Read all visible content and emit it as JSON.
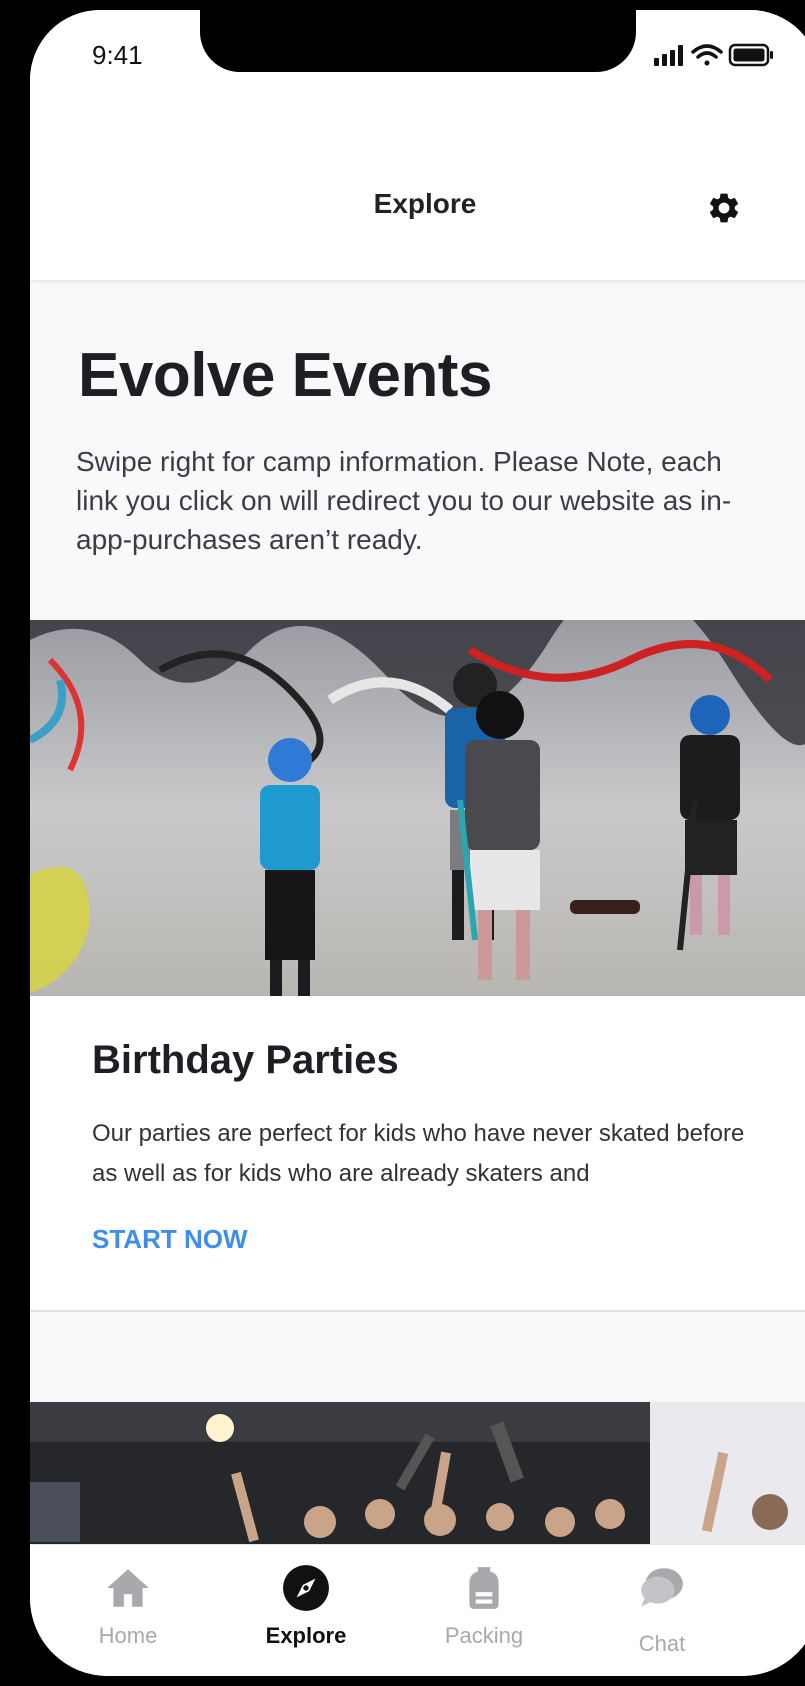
{
  "status_bar": {
    "time": "9:41"
  },
  "nav": {
    "title": "Explore"
  },
  "hero": {
    "title": "Evolve Events",
    "description": "Swipe right for camp information. Please Note, each link you click on will redirect you to our website as in-app-purchases aren’t ready."
  },
  "cards": [
    {
      "title": "Birthday Parties",
      "text": "Our parties are perfect for kids who have never skated before as well as for kids who are already skaters and",
      "cta": "START NOW"
    }
  ],
  "tabs": [
    {
      "label": "Home",
      "icon": "home-icon",
      "active": false
    },
    {
      "label": "Explore",
      "icon": "compass-icon",
      "active": true
    },
    {
      "label": "Packing",
      "icon": "backpack-icon",
      "active": false
    },
    {
      "label": "Chat",
      "icon": "chat-bubble-icon",
      "active": false
    }
  ],
  "colors": {
    "accent": "#3e8ef0",
    "inactive_tab": "#a9a9ad",
    "active_tab": "#111111"
  }
}
